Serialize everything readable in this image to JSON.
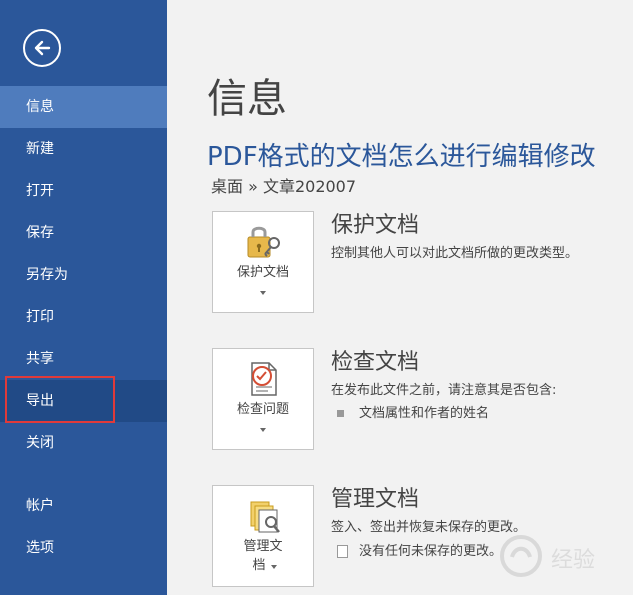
{
  "sidebar": {
    "back_label": "",
    "items": [
      {
        "label": "信息",
        "state": "active"
      },
      {
        "label": "新建"
      },
      {
        "label": "打开"
      },
      {
        "label": "保存"
      },
      {
        "label": "另存为"
      },
      {
        "label": "打印"
      },
      {
        "label": "共享"
      },
      {
        "label": "导出",
        "state": "hover"
      },
      {
        "label": "关闭"
      },
      {
        "label": "帐户"
      },
      {
        "label": "选项"
      }
    ]
  },
  "main": {
    "page_title": "信息",
    "document_title": "PDF格式的文档怎么进行编辑修改",
    "breadcrumb": "桌面 » 文章202007",
    "sections": [
      {
        "tile_label": "保护文档",
        "title": "保护文档",
        "description": "控制其他人可以对此文档所做的更改类型。",
        "icon": "lock-key-icon"
      },
      {
        "tile_label": "检查问题",
        "title": "检查文档",
        "description": "在发布此文件之前，请注意其是否包含:",
        "bullet": "文档属性和作者的姓名",
        "icon": "inspect-document-icon"
      },
      {
        "tile_label_line1": "管理文",
        "tile_label_line2": "档",
        "title": "管理文档",
        "description": "签入、签出并恢复未保存的更改。",
        "bullet": "没有任何未保存的更改。",
        "icon": "manage-documents-icon"
      }
    ]
  },
  "watermark": {
    "text": "经验"
  },
  "colors": {
    "sidebar": "#2b579a",
    "active_item": "#4f7cbd",
    "accent_text": "#2b579a",
    "highlight_border": "#e03a3a"
  }
}
